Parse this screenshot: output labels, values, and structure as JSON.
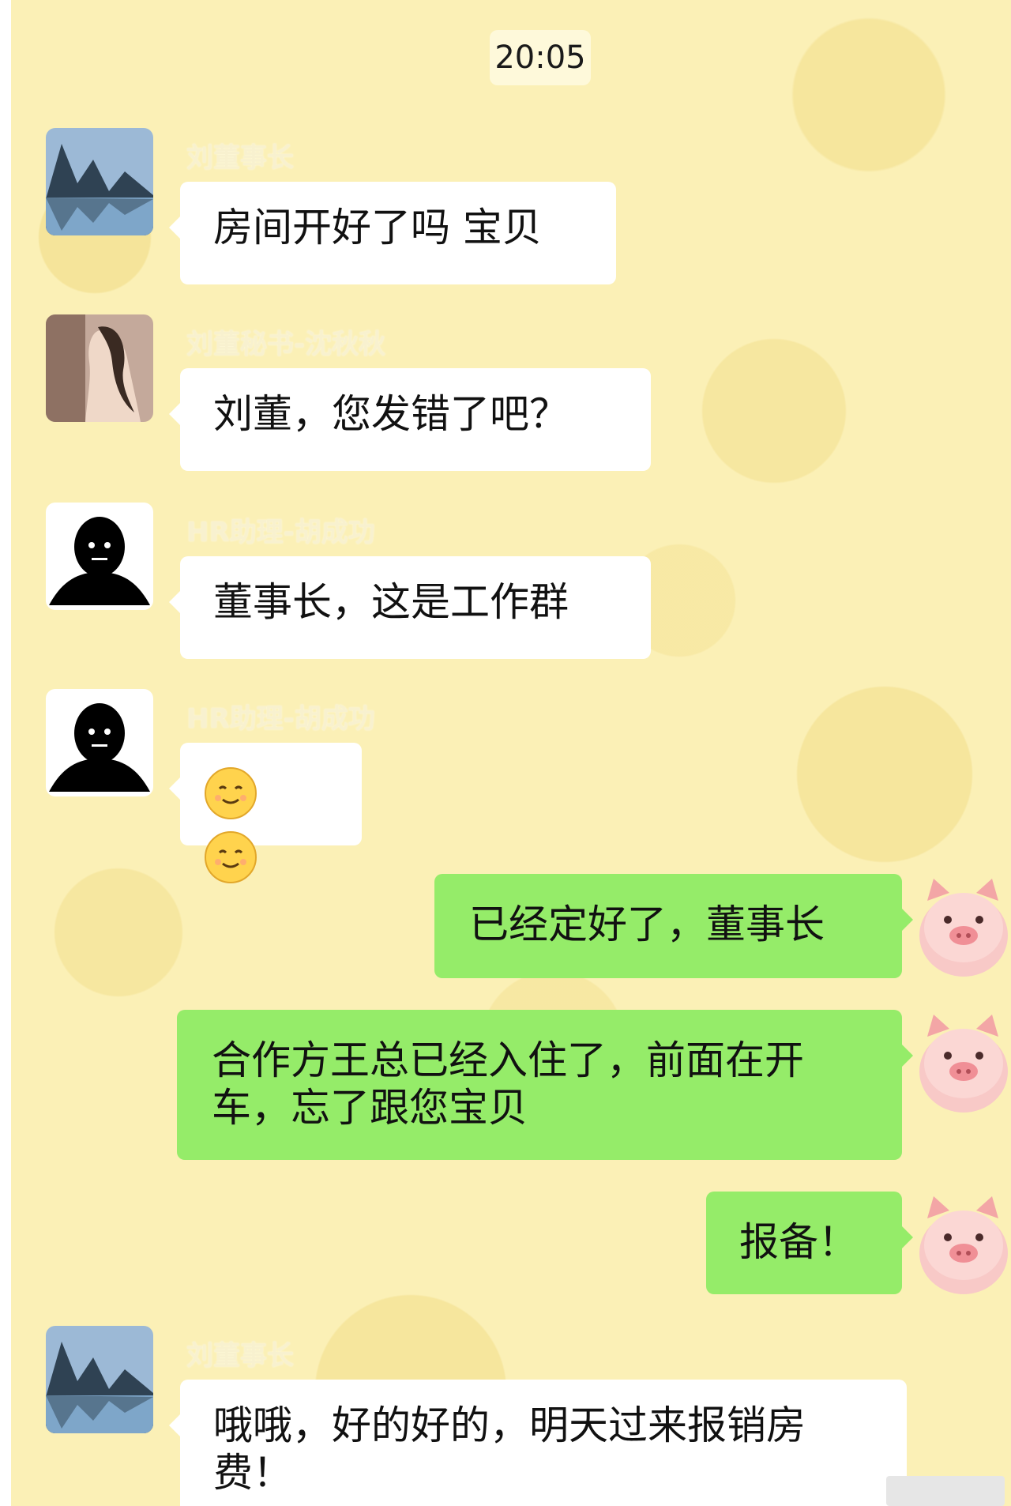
{
  "chat": {
    "time": "20:05",
    "messages": [
      {
        "sender": "刘董事长",
        "text": "房间开好了吗 宝贝",
        "side": "left",
        "avatar": "mountain-lake-avatar"
      },
      {
        "sender": "刘董秘书-沈秋秋",
        "text": "刘董，您发错了吧？",
        "side": "left",
        "avatar": "woman-photo-avatar"
      },
      {
        "sender": "HR助理-胡成功",
        "text": "董事长，这是工作群",
        "side": "left",
        "avatar": "black-figure-avatar"
      },
      {
        "sender": "HR助理-胡成功",
        "text": "",
        "side": "left",
        "avatar": "black-figure-avatar",
        "emojis": [
          "smile-emoji",
          "smile-emoji"
        ]
      },
      {
        "text": "已经定好了，董事长",
        "side": "right",
        "avatar": "pig-avatar"
      },
      {
        "text": "合作方王总已经入住了，前面在开车，忘了跟您宝贝",
        "side": "right",
        "avatar": "pig-avatar"
      },
      {
        "text": "报备！",
        "side": "right",
        "avatar": "pig-avatar"
      },
      {
        "sender": "刘董事长",
        "text": "哦哦，好的好的，明天过来报销房费！",
        "side": "left",
        "avatar": "mountain-lake-avatar"
      }
    ]
  },
  "colors": {
    "background": "#fbf0b6",
    "bubble_left": "#ffffff",
    "bubble_right": "#95ec69",
    "sender_name": "#f8f1cf"
  }
}
